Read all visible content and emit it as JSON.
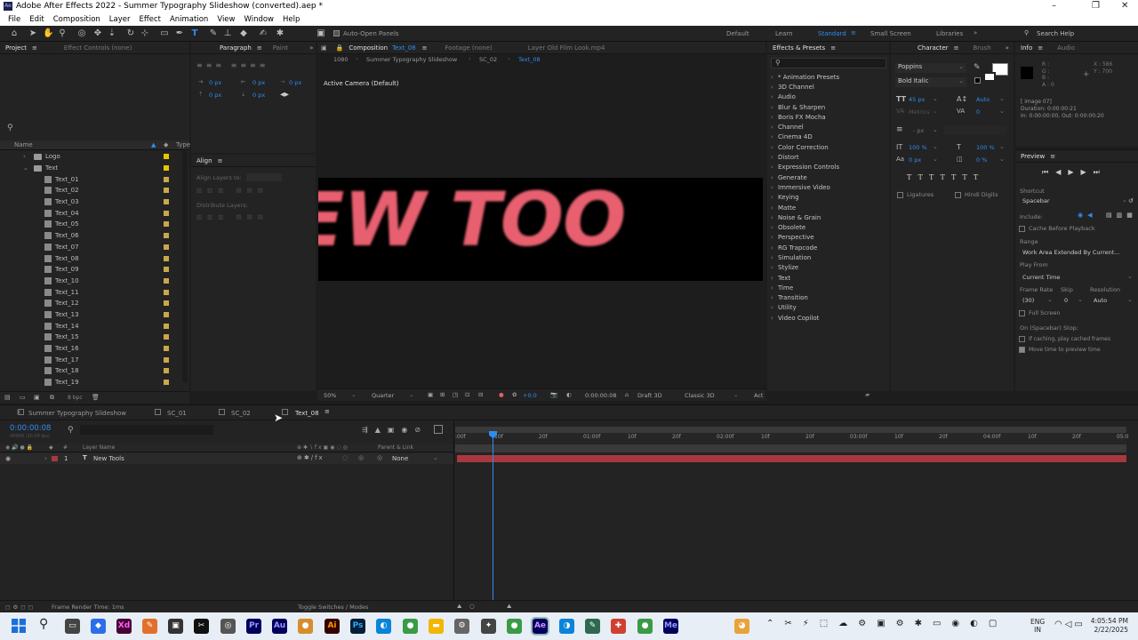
{
  "window": {
    "title": "Adobe After Effects 2022 - Summer Typography Slideshow (converted).aep *"
  },
  "menu": [
    "File",
    "Edit",
    "Composition",
    "Layer",
    "Effect",
    "Animation",
    "View",
    "Window",
    "Help"
  ],
  "toolbar": {
    "auto_open": "Auto-Open Panels",
    "workspaces": [
      "Default",
      "Learn",
      "Standard",
      "Small Screen",
      "Libraries"
    ],
    "active_workspace": "Standard",
    "search_placeholder": "Search Help"
  },
  "project": {
    "tabs": [
      "Project",
      "Effect Controls (none)"
    ],
    "col_name": "Name",
    "col_type": "Type",
    "folders": [
      "Logo",
      "Text"
    ],
    "items": [
      "Text_01",
      "Text_02",
      "Text_03",
      "Text_04",
      "Text_05",
      "Text_06",
      "Text_07",
      "Text_08",
      "Text_09",
      "Text_10",
      "Text_11",
      "Text_12",
      "Text_13",
      "Text_14",
      "Text_15",
      "Text_16",
      "Text_17",
      "Text_18",
      "Text_19"
    ],
    "swatch_colors": [
      "#e6c600",
      "#e6c600",
      "#c9a84a",
      "#c9a84a",
      "#c9a84a",
      "#c9a84a",
      "#c9a84a",
      "#c9a84a",
      "#c9a84a",
      "#c9a84a",
      "#c9a84a",
      "#c9a84a",
      "#c9a84a",
      "#c9a84a",
      "#c9a84a",
      "#c9a84a",
      "#c9a84a",
      "#c9a84a",
      "#c9a84a",
      "#c9a84a",
      "#c9a84a"
    ],
    "bpc": "8 bpc"
  },
  "paragraph": {
    "tabs": [
      "Paragraph",
      "Paint"
    ],
    "fields": [
      "0 px",
      "0 px",
      "0 px",
      "0 px",
      "0 px"
    ]
  },
  "align": {
    "title": "Align",
    "align_layers_to": "Align Layers to:",
    "distribute": "Distribute Layers:"
  },
  "composition": {
    "tab": "Composition",
    "tab_name": "Text_08",
    "footage": "Footage (none)",
    "layer": "Layer Old Film Look.mp4",
    "crumbs": [
      "1080",
      "Summer Typography Slideshow",
      "SC_02",
      "Text_08"
    ],
    "camera": "Active Camera (Default)",
    "preview_text": "EW TOO",
    "zoom": "50%",
    "resolution": "Quarter",
    "exposure": "+0.0",
    "timecode": "0:00:00:08",
    "draft": "Draft 3D",
    "renderer": "Classic 3D",
    "act": "Act"
  },
  "effects": {
    "title": "Effects & Presets",
    "items": [
      "* Animation Presets",
      "3D Channel",
      "Audio",
      "Blur & Sharpen",
      "Boris FX Mocha",
      "Channel",
      "Cinema 4D",
      "Color Correction",
      "Distort",
      "Expression Controls",
      "Generate",
      "Immersive Video",
      "Keying",
      "Matte",
      "Noise & Grain",
      "Obsolete",
      "Perspective",
      "RG Trapcode",
      "Simulation",
      "Stylize",
      "Text",
      "Time",
      "Transition",
      "Utility",
      "Video Copilot"
    ]
  },
  "character": {
    "tabs": [
      "Character",
      "Brush"
    ],
    "font": "Poppins",
    "style": "Bold Italic",
    "size": "45 px",
    "leading": "Auto",
    "kerning": "Metrics",
    "tracking": "0",
    "stroke_unit": "- px",
    "vscale": "100 %",
    "hscale": "100 %",
    "baseline": "0 px",
    "tsume": "0 %",
    "ligatures": "Ligatures",
    "hindi": "Hindi Digits"
  },
  "info": {
    "tabs": [
      "Info",
      "Audio"
    ],
    "rgb": [
      "R :",
      "G :",
      "B :",
      "A : 0"
    ],
    "xy": [
      "X : 586",
      "Y : 700"
    ],
    "details": [
      "[ image 07]",
      "Duration: 0:00:00:21",
      "In: 0:00:00:00, Out: 0:00:00:20"
    ]
  },
  "preview": {
    "title": "Preview",
    "shortcut_label": "Shortcut",
    "shortcut": "Spacebar",
    "include": "Include:",
    "cache": "Cache Before Playback",
    "range_label": "Range",
    "range": "Work Area Extended By Current...",
    "play_from_label": "Play From",
    "play_from": "Current Time",
    "fr_label": "Frame Rate",
    "skip_label": "Skip",
    "res_label": "Resolution",
    "fr": "(30)",
    "skip": "0",
    "res": "Auto",
    "full_screen": "Full Screen",
    "stop_label": "On (Spacebar) Stop:",
    "if_caching": "If caching, play cached frames",
    "move_time": "Move time to preview time"
  },
  "timeline": {
    "tabs": [
      "Summer Typography Slideshow",
      "SC_01",
      "SC_02",
      "Text_08"
    ],
    "timecode": "0:00:00:08",
    "fps": "00008 (30.00 fps)",
    "col_layer": "Layer Name",
    "col_parent": "Parent & Link",
    "layer_num": "1",
    "layer_name": "New Tools",
    "parent": "None",
    "ruler": [
      ":00f",
      "10f",
      "20f",
      "01:00f",
      "10f",
      "20f",
      "02:00f",
      "10f",
      "20f",
      "03:00f",
      "10f",
      "20f",
      "04:00f",
      "10f",
      "20f",
      "05:0"
    ],
    "render_time": "Frame Render Time: 1ms",
    "toggle": "Toggle Switches / Modes"
  },
  "taskbar": {
    "lang": [
      "ENG",
      "IN"
    ],
    "time": "4:05:54 PM",
    "date": "2/22/2025"
  },
  "colors": {
    "accent": "#2f8cf0",
    "text_pink": "#e8606f",
    "layer_bar": "#a8383f"
  }
}
